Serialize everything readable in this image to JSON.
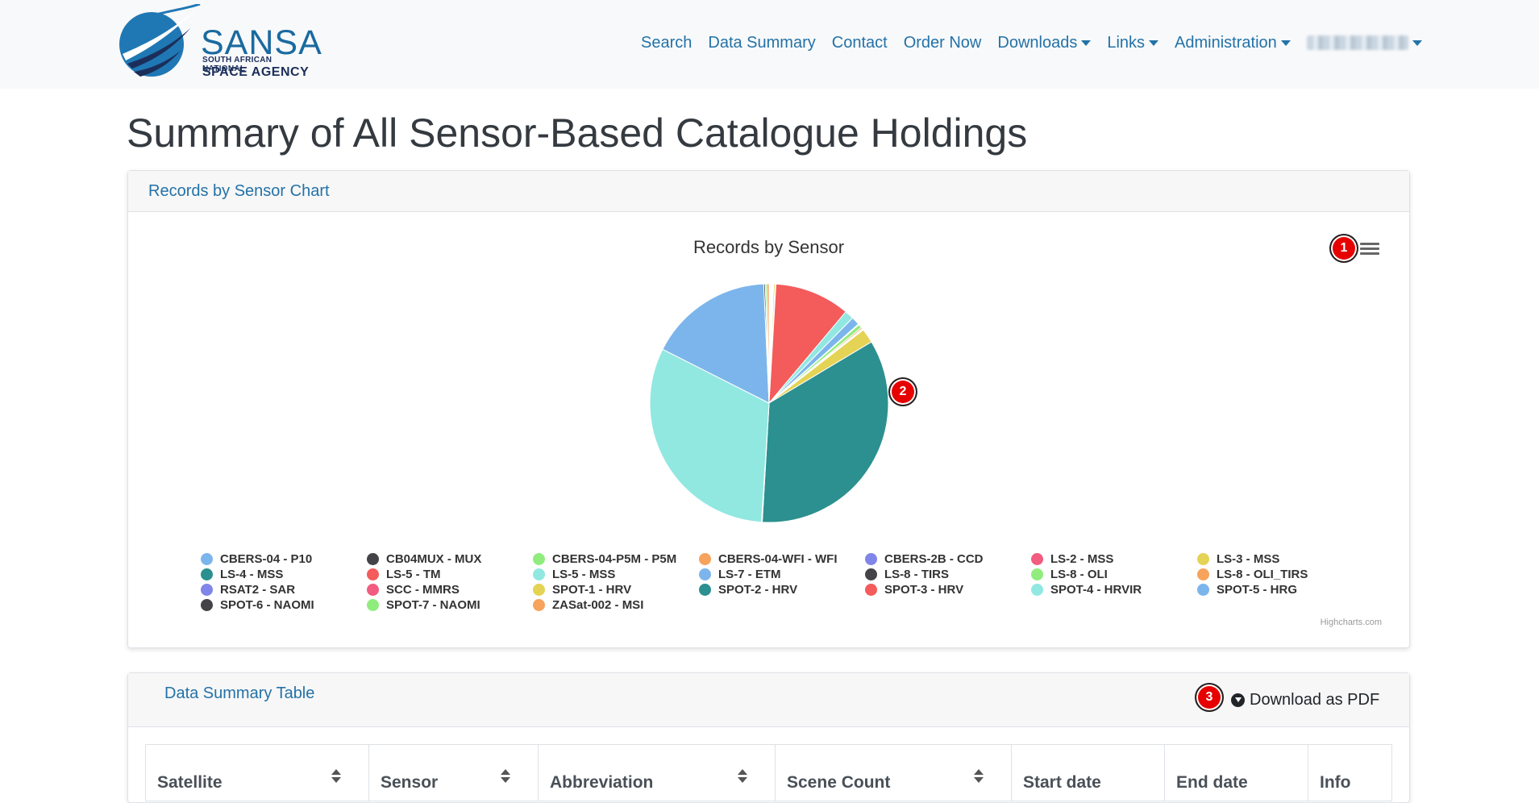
{
  "brand": {
    "name": "SANSA",
    "line1": "SOUTH AFRICAN NATIONAL",
    "line2": "SPACE AGENCY"
  },
  "nav": {
    "items": [
      {
        "label": "Search",
        "dropdown": false
      },
      {
        "label": "Data Summary",
        "dropdown": false
      },
      {
        "label": "Contact",
        "dropdown": false
      },
      {
        "label": "Order Now",
        "dropdown": false
      },
      {
        "label": "Downloads",
        "dropdown": true
      },
      {
        "label": "Links",
        "dropdown": true
      },
      {
        "label": "Administration",
        "dropdown": true
      }
    ],
    "user_blurred": true
  },
  "page": {
    "title": "Summary of All Sensor-Based Catalogue Holdings"
  },
  "chart_card": {
    "header": "Records by Sensor Chart",
    "credits": "Highcharts.com",
    "badge_menu": "1",
    "badge_pie": "2"
  },
  "chart_data": {
    "type": "pie",
    "title": "Records by Sensor",
    "slices": [
      {
        "name": "CBERS-04 - P10",
        "value": 0.1,
        "color": "#7cb5ec"
      },
      {
        "name": "CB04MUX - MUX",
        "value": 0.1,
        "color": "#434348"
      },
      {
        "name": "CBERS-04-P5M - P5M",
        "value": 0.1,
        "color": "#90ed7d"
      },
      {
        "name": "CBERS-04-WFI - WFI",
        "value": 0.1,
        "color": "#f7a35c"
      },
      {
        "name": "CBERS-2B - CCD",
        "value": 0.1,
        "color": "#8085e9"
      },
      {
        "name": "LS-2 - MSS",
        "value": 0.1,
        "color": "#f15c80"
      },
      {
        "name": "LS-3 - MSS",
        "value": 0.2,
        "color": "#e4d354"
      },
      {
        "name": "LS-4 - MSS",
        "value": 0.1,
        "color": "#2b908f"
      },
      {
        "name": "LS-5 - TM",
        "value": 10.0,
        "color": "#f45b5b"
      },
      {
        "name": "LS-5 - MSS",
        "value": 1.2,
        "color": "#91e8e1"
      },
      {
        "name": "LS-7 - ETM",
        "value": 1.1,
        "color": "#7cb5ec"
      },
      {
        "name": "LS-8 - TIRS",
        "value": 0.1,
        "color": "#434348"
      },
      {
        "name": "LS-8 - OLI",
        "value": 0.5,
        "color": "#90ed7d"
      },
      {
        "name": "LS-8 - OLI_TIRS",
        "value": 0.2,
        "color": "#f7a35c"
      },
      {
        "name": "RSAT2 - SAR",
        "value": 0.1,
        "color": "#8085e9"
      },
      {
        "name": "SCC - MMRS",
        "value": 0.1,
        "color": "#f15c80"
      },
      {
        "name": "SPOT-1 - HRV",
        "value": 1.9,
        "color": "#e4d354"
      },
      {
        "name": "SPOT-2 - HRV",
        "value": 33.8,
        "color": "#2b908f"
      },
      {
        "name": "SPOT-3 - HRV",
        "value": 0.1,
        "color": "#f45b5b"
      },
      {
        "name": "SPOT-4 - HRVIR",
        "value": 30.8,
        "color": "#91e8e1"
      },
      {
        "name": "SPOT-5 - HRG",
        "value": 16.5,
        "color": "#7cb5ec"
      },
      {
        "name": "SPOT-6 - NAOMI",
        "value": 0.2,
        "color": "#434348"
      },
      {
        "name": "SPOT-7 - NAOMI",
        "value": 0.2,
        "color": "#90ed7d"
      },
      {
        "name": "ZASat-002 - MSI",
        "value": 0.3,
        "color": "#f7a35c"
      }
    ],
    "legend_placement": "bottom"
  },
  "table_card": {
    "header": "Data Summary Table",
    "download_label": "Download as PDF",
    "badge_download": "3",
    "columns": [
      {
        "label": "Satellite",
        "sortable": true
      },
      {
        "label": "Sensor",
        "sortable": true
      },
      {
        "label": "Abbreviation",
        "sortable": true
      },
      {
        "label": "Scene Count",
        "sortable": true
      },
      {
        "label": "Start date",
        "sortable": false
      },
      {
        "label": "End date",
        "sortable": false
      },
      {
        "label": "Info",
        "sortable": false
      }
    ]
  }
}
